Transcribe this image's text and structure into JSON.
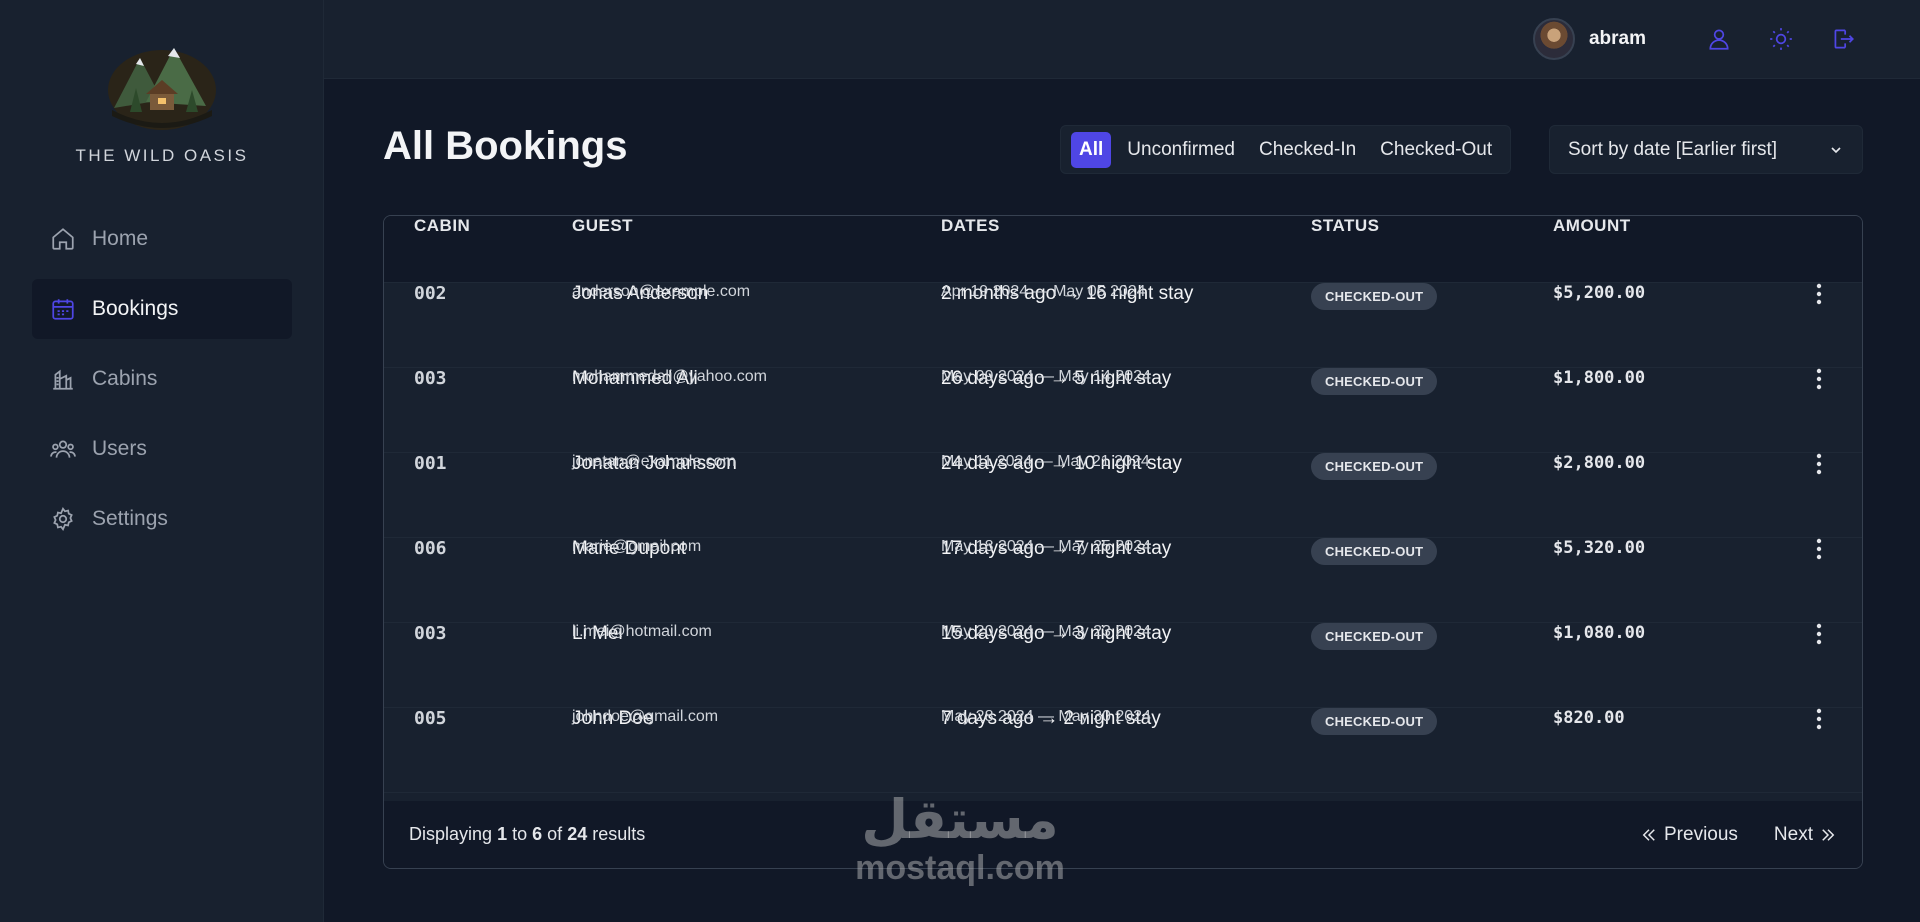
{
  "brand": {
    "name": "THE WILD OASIS"
  },
  "sidebar": {
    "items": [
      {
        "label": "Home",
        "icon": "home-icon",
        "active": false
      },
      {
        "label": "Bookings",
        "icon": "calendar-icon",
        "active": true
      },
      {
        "label": "Cabins",
        "icon": "cabins-icon",
        "active": false
      },
      {
        "label": "Users",
        "icon": "users-icon",
        "active": false
      },
      {
        "label": "Settings",
        "icon": "gear-icon",
        "active": false
      }
    ]
  },
  "header": {
    "username": "abram",
    "icons": [
      "user-icon",
      "sun-icon",
      "logout-icon"
    ]
  },
  "main": {
    "title": "All Bookings",
    "filters": [
      "All",
      "Unconfirmed",
      "Checked-In",
      "Checked-Out"
    ],
    "active_filter": "All",
    "sort_value": "Sort by date [Earlier first]"
  },
  "table": {
    "columns": [
      "CABIN",
      "GUEST",
      "DATES",
      "STATUS",
      "AMOUNT"
    ],
    "rows": [
      {
        "cabin": "002",
        "guest": "Jonas Anderson",
        "email": "anderson@example.com",
        "stay": "2 months ago → 16 night stay",
        "range": "Apr 19 2024 — May 05 2024",
        "status": "CHECKED-OUT",
        "amount": "$5,200.00"
      },
      {
        "cabin": "003",
        "guest": "Mohammed Ali",
        "email": "mohammedali@yahoo.com",
        "stay": "26 days ago → 5 night stay",
        "range": "May 09 2024 — May 14 2024",
        "status": "CHECKED-OUT",
        "amount": "$1,800.00"
      },
      {
        "cabin": "001",
        "guest": "Jonatan Johansson",
        "email": "jonatan@example.com",
        "stay": "24 days ago → 10 night stay",
        "range": "May 11 2024 — May 21 2024",
        "status": "CHECKED-OUT",
        "amount": "$2,800.00"
      },
      {
        "cabin": "006",
        "guest": "Marie Dupont",
        "email": "marie@gmail.com",
        "stay": "17 days ago → 7 night stay",
        "range": "May 18 2024 — May 25 2024",
        "status": "CHECKED-OUT",
        "amount": "$5,320.00"
      },
      {
        "cabin": "003",
        "guest": "Li Mei",
        "email": "li.mei@hotmail.com",
        "stay": "15 days ago → 3 night stay",
        "range": "May 20 2024 — May 23 2024",
        "status": "CHECKED-OUT",
        "amount": "$1,080.00"
      },
      {
        "cabin": "005",
        "guest": "John Doe",
        "email": "johndoe@gmail.com",
        "stay": "7 days ago → 2 night stay",
        "range": "May 28 2024 — May 30 2024",
        "status": "CHECKED-OUT",
        "amount": "$820.00"
      }
    ]
  },
  "footer": {
    "displaying": "Displaying",
    "from": "1",
    "to_word": "to",
    "to": "6",
    "of_word": "of",
    "total": "24",
    "results": "results",
    "prev_label": "Previous",
    "next_label": "Next"
  },
  "watermark": {
    "arabic": "مستقل",
    "latin": "mostaql.com"
  },
  "colors": {
    "accent": "#4f46e5",
    "bg": "#111827",
    "panel": "#18212f",
    "badge": "#374151"
  }
}
